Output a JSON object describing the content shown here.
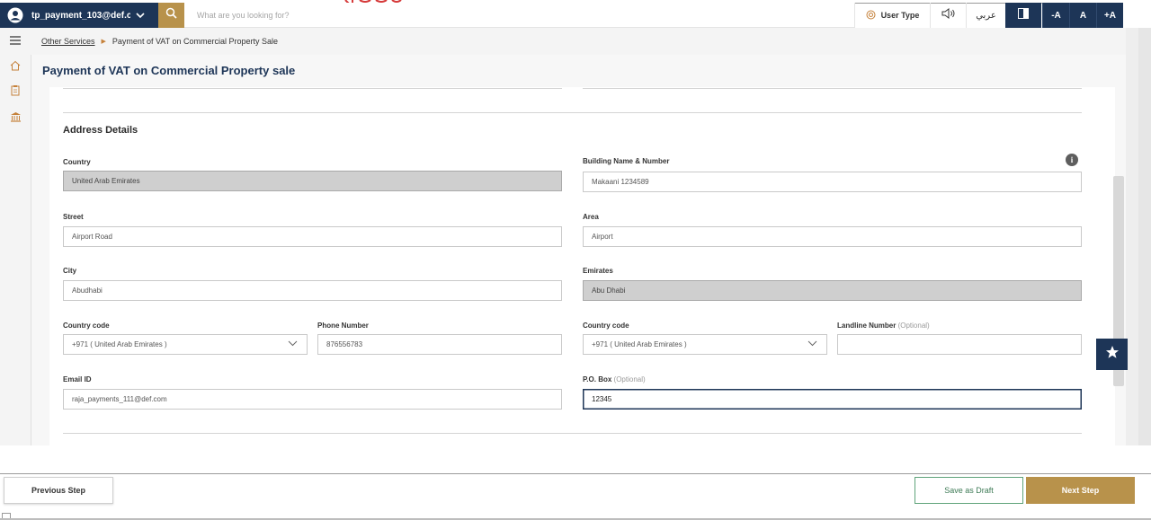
{
  "topbar": {
    "user_name": "tp_payment_103@def.c...",
    "search_placeholder": "What are you looking for?",
    "user_type_label": "User Type",
    "language_label": "عربي",
    "font_decrease": "-A",
    "font_normal": "A",
    "font_increase": "+A",
    "colors": {
      "navy": "#1d3557",
      "gold": "#b8924b"
    }
  },
  "breadcrumb": {
    "parent": "Other Services",
    "current": "Payment of VAT on Commercial Property Sale"
  },
  "page": {
    "title": "Payment of VAT on Commercial Property sale"
  },
  "address": {
    "section_title": "Address Details",
    "country": {
      "label": "Country",
      "value": "United Arab Emirates"
    },
    "building": {
      "label": "Building Name & Number",
      "value": "Makaani 1234589"
    },
    "street": {
      "label": "Street",
      "value": "Airport Road"
    },
    "area": {
      "label": "Area",
      "value": "Airport"
    },
    "city": {
      "label": "City",
      "value": "Abudhabi"
    },
    "emirates": {
      "label": "Emirates",
      "value": "Abu Dhabi"
    },
    "country_code_1": {
      "label": "Country code",
      "value": "+971 ( United Arab Emirates )"
    },
    "phone": {
      "label": "Phone Number",
      "value": "876556783"
    },
    "country_code_2": {
      "label": "Country code",
      "value": "+971 ( United Arab Emirates )"
    },
    "landline": {
      "label": "Landline Number",
      "optional": "(Optional)",
      "value": ""
    },
    "email": {
      "label": "Email ID",
      "value": "raja_payments_111@def.com"
    },
    "pobox": {
      "label": "P.O. Box",
      "optional": "(Optional)",
      "value": "12345"
    }
  },
  "footer": {
    "previous": "Previous Step",
    "save_draft": "Save as Draft",
    "next": "Next Step"
  },
  "icons": [
    "user-icon",
    "chevron-down-icon",
    "search-icon",
    "gear-icon",
    "speaker-icon",
    "contrast-icon",
    "menu-icon",
    "home-icon",
    "clipboard-icon",
    "bank-icon",
    "info-icon",
    "star-icon"
  ]
}
